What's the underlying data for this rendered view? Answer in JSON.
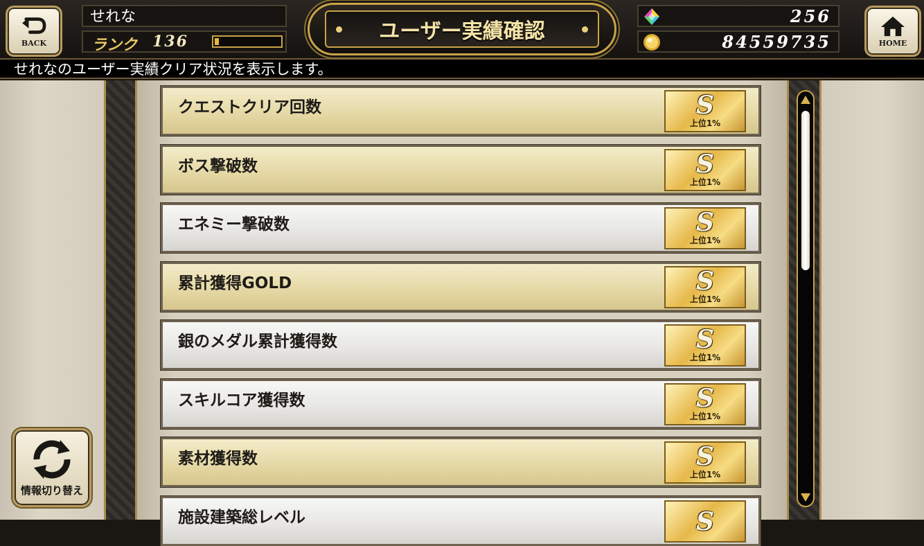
{
  "header": {
    "back_label": "BACK",
    "home_label": "HOME",
    "player_name": "せれな",
    "rank_label": "ランク",
    "rank_value": "136",
    "rank_progress": 0.06,
    "title": "ユーザー実績確認",
    "gems": "256",
    "gold": "84559735"
  },
  "info_text": "せれなのユーザー実績クリア状況を表示します。",
  "achievements": [
    {
      "label": "クエストクリア回数",
      "rank": "S",
      "sub": "上位1%",
      "style": "gold"
    },
    {
      "label": "ボス撃破数",
      "rank": "S",
      "sub": "上位1%",
      "style": "gold"
    },
    {
      "label": "エネミー撃破数",
      "rank": "S",
      "sub": "上位1%",
      "style": "silver"
    },
    {
      "label": "累計獲得GOLD",
      "rank": "S",
      "sub": "上位1%",
      "style": "gold"
    },
    {
      "label": "銀のメダル累計獲得数",
      "rank": "S",
      "sub": "上位1%",
      "style": "silver"
    },
    {
      "label": "スキルコア獲得数",
      "rank": "S",
      "sub": "上位1%",
      "style": "silver"
    },
    {
      "label": "素材獲得数",
      "rank": "S",
      "sub": "上位1%",
      "style": "gold"
    },
    {
      "label": "施設建築総レベル",
      "rank": "S",
      "sub": "",
      "style": "silver"
    }
  ],
  "switch_label": "情報切り替え",
  "icons": {
    "back": "back-arrow-icon",
    "home": "house-icon",
    "gem": "gem-icon",
    "gold": "gold-coin-icon",
    "switch": "refresh-icon"
  }
}
